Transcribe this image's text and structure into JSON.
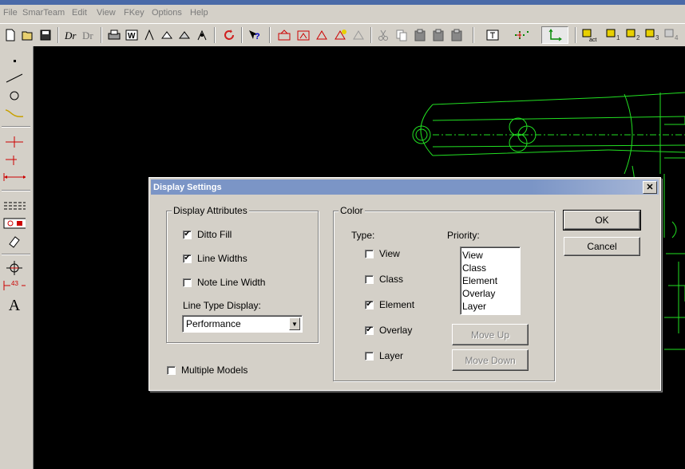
{
  "menu": {
    "items": [
      "File",
      "SmarTeam",
      "Edit",
      "View",
      "FKey",
      "Options",
      "Help"
    ]
  },
  "toolbar": {
    "buttons": [
      "new-icon",
      "open-icon",
      "save-icon",
      "dr-icon",
      "dr2-icon",
      "print-icon",
      "w-icon",
      "hand-icon",
      "hand2-icon",
      "hand3-icon",
      "hand4-icon",
      "refresh-icon",
      "help-icon",
      "view1-icon",
      "view2-icon",
      "view3-icon",
      "view4-icon",
      "view5-icon",
      "cut-icon",
      "copy-icon",
      "paste-icon",
      "paste2-icon",
      "paste3-icon",
      "frame-icon",
      "grid-icon",
      "axis-icon",
      "sheet-icon",
      "sheet1-icon",
      "sheet2-icon",
      "sheet3-icon",
      "sheet4-icon"
    ],
    "sheet_labels": [
      "1",
      "2",
      "3",
      "4"
    ]
  },
  "left_toolbar": {
    "tools": [
      "point-icon",
      "line-icon",
      "circle-icon",
      "curve-icon",
      "cross-icon",
      "cross2-icon",
      "dimension-icon",
      "hatch-icon",
      "fill-icon",
      "eraser-icon",
      "center-icon",
      "measure-icon",
      "text-icon"
    ],
    "measure_value": "43",
    "text_glyph": "A"
  },
  "dialog": {
    "title": "Display Settings",
    "close_glyph": "✕",
    "display_attributes": {
      "label": "Display Attributes",
      "ditto_fill": {
        "label": "Ditto Fill",
        "checked": true
      },
      "line_widths": {
        "label": "Line Widths",
        "checked": true
      },
      "note_line_width": {
        "label": "Note Line Width",
        "checked": false
      },
      "line_type_label": "Line Type Display:",
      "line_type_value": "Performance"
    },
    "multiple_models": {
      "label": "Multiple Models",
      "checked": false
    },
    "color": {
      "label": "Color",
      "type_label": "Type:",
      "priority_label": "Priority:",
      "types": [
        {
          "label": "View",
          "checked": false
        },
        {
          "label": "Class",
          "checked": false
        },
        {
          "label": "Element",
          "checked": true
        },
        {
          "label": "Overlay",
          "checked": true
        },
        {
          "label": "Layer",
          "checked": false
        }
      ],
      "priority": [
        "View",
        "Class",
        "Element",
        "Overlay",
        "Layer"
      ],
      "move_up": "Move Up",
      "move_down": "Move Down"
    },
    "ok": "OK",
    "cancel": "Cancel"
  },
  "colors": {
    "drawing": "#22e022",
    "canvas": "#000000",
    "title_active": "#7b95c6"
  }
}
